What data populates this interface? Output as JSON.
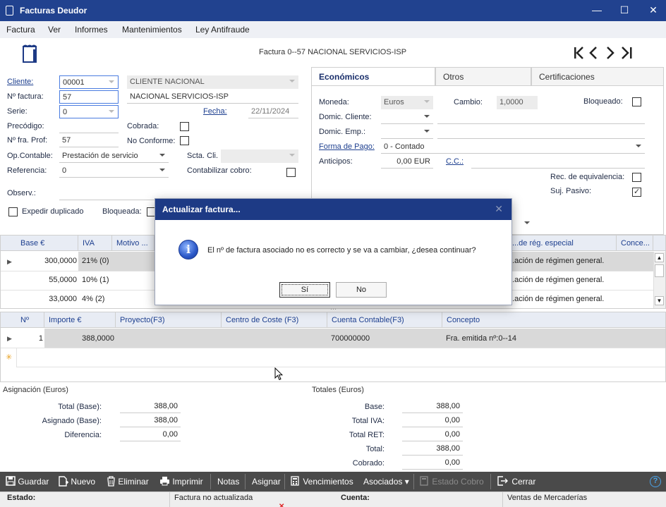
{
  "window": {
    "title": "Facturas Deudor",
    "minimize": "—",
    "maximize": "☐",
    "close": "✕"
  },
  "menu": [
    "Factura",
    "Ver",
    "Informes",
    "Mantenimientos",
    "Ley Antifraude"
  ],
  "header": {
    "title": "Factura 0--57 NACIONAL SERVICIOS-ISP"
  },
  "form": {
    "cliente_label": "Cliente:",
    "cliente_code": "00001",
    "cliente_name": "CLIENTE NACIONAL",
    "nfactura_label": "Nº factura:",
    "nfactura_value": "57",
    "nfactura_desc": "NACIONAL SERVICIOS-ISP",
    "serie_label": "Serie:",
    "serie_value": "0",
    "fecha_label": "Fecha:",
    "fecha_value": "22/11/2024",
    "precodigo_label": "Precódigo:",
    "cobrada_label": "Cobrada:",
    "nfraprof_label": "Nº fra. Prof:",
    "nfraprof_value": "57",
    "noconforme_label": "No Conforme:",
    "opcontable_label": "Op.Contable:",
    "opcontable_value": "Prestación de servicio",
    "sctacli_label": "Scta. Cli.",
    "referencia_label": "Referencia:",
    "referencia_value": "0",
    "contabilizar_label": "Contabilizar cobro:",
    "observ_label": "Observ.:",
    "expedir_label": "Expedir duplicado",
    "bloqueada_label": "Bloqueada:"
  },
  "tabs": [
    "Económicos",
    "Otros",
    "Certificaciones"
  ],
  "economicos": {
    "moneda_label": "Moneda:",
    "moneda_value": "Euros",
    "cambio_label": "Cambio:",
    "cambio_value": "1,0000",
    "bloqueado_label": "Bloqueado:",
    "domic_cliente_label": "Domic. Cliente:",
    "domic_emp_label": "Domic. Emp.:",
    "forma_pago_label": "Forma de Pago:",
    "forma_pago_value": "0 - Contado",
    "anticipos_label": "Anticipos:",
    "anticipos_value": "0,00 EUR",
    "cc_label": "C.C.:",
    "rec_equiv_label": "Rec. de equivalencia:",
    "suj_pasivo_label": "Suj. Pasivo:",
    "suj_pasivo_checked": true
  },
  "iva_grid": {
    "headers": [
      "Base €",
      "IVA",
      "Motivo ...",
      "...de rég. especial",
      "Conce..."
    ],
    "rows": [
      {
        "base": "300,0000",
        "iva": "21% (0)",
        "motivo": "...ación de régimen general."
      },
      {
        "base": "55,0000",
        "iva": "10% (1)",
        "motivo": "...ación de régimen general."
      },
      {
        "base": "33,0000",
        "iva": "4% (2)",
        "motivo": "...ación de régimen general."
      }
    ]
  },
  "dist_grid": {
    "headers": [
      "Nº",
      "Importe €",
      "Proyecto(F3)",
      "Centro de Coste (F3)",
      "Cuenta Contable(F3)",
      "Concepto"
    ],
    "rows": [
      {
        "n": "1",
        "importe": "388,0000",
        "proyecto": "",
        "centro": "",
        "cuenta": "700000000",
        "concepto": "Fra. emitida nº:0--14"
      }
    ],
    "new_row_marker": "✳"
  },
  "asignacion": {
    "title": "Asignación (Euros)",
    "total_base_label": "Total (Base):",
    "total_base": "388,00",
    "asignado_label": "Asignado (Base):",
    "asignado": "388,00",
    "diferencia_label": "Diferencia:",
    "diferencia": "0,00"
  },
  "totales": {
    "title": "Totales (Euros)",
    "base_label": "Base:",
    "base": "388,00",
    "iva_label": "Total IVA:",
    "iva": "0,00",
    "ret_label": "Total RET:",
    "ret": "0,00",
    "total_label": "Total:",
    "total": "388,00",
    "cobrado_label": "Cobrado:",
    "cobrado": "0,00"
  },
  "toolbar": {
    "guardar": "Guardar",
    "nuevo": "Nuevo",
    "eliminar": "Eliminar",
    "imprimir": "Imprimir",
    "notas": "Notas",
    "asignar": "Asignar",
    "vencimientos": "Vencimientos",
    "asociados": "Asociados ▾",
    "estado_cobro": "Estado Cobro",
    "cerrar": "Cerrar",
    "help": "?"
  },
  "status": {
    "estado_label": "Estado:",
    "estado_value": "Factura no actualizada",
    "cuenta_label": "Cuenta:",
    "cuenta_value": "Ventas de Mercaderías"
  },
  "dialog": {
    "title": "Actualizar factura...",
    "close": "✕",
    "icon": "i",
    "message": "El nº de factura asociado no es correcto y se va a cambiar, ¿desea continuar?",
    "yes": "Sí",
    "no": "No"
  }
}
